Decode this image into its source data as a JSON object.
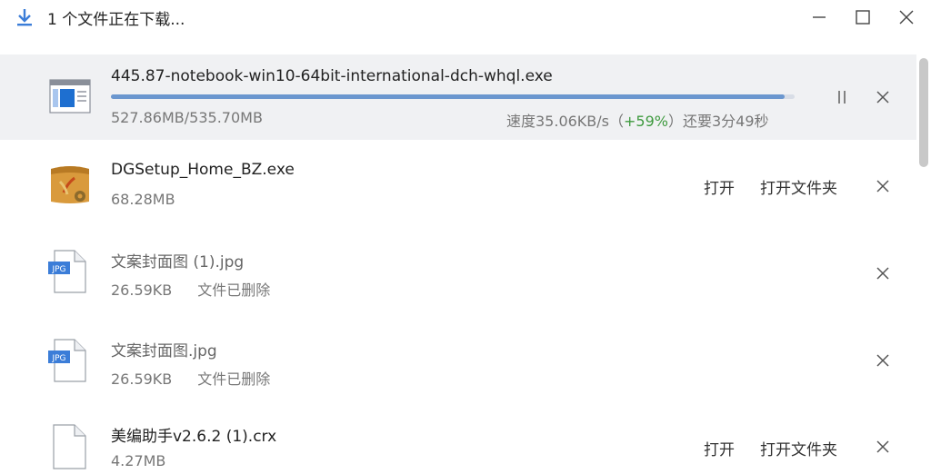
{
  "window": {
    "title": "1 个文件正在下载..."
  },
  "downloads": [
    {
      "name": "445.87-notebook-win10-64bit-international-dch-whql.exe",
      "size": "527.86MB/535.70MB",
      "speed_prefix": "速度35.06KB/s（",
      "speed_pct": "+59%",
      "speed_suffix": "）还要3分49秒",
      "progress_fraction": 0.985,
      "icon": "installer-window-icon"
    },
    {
      "name": "DGSetup_Home_BZ.exe",
      "size": "68.28MB",
      "open_label": "打开",
      "open_folder_label": "打开文件夹",
      "icon": "app-package-icon"
    },
    {
      "name": "文案封面图 (1).jpg",
      "size": "26.59KB",
      "status": "文件已删除",
      "icon": "jpg-file-icon"
    },
    {
      "name": "文案封面图.jpg",
      "size": "26.59KB",
      "status": "文件已删除",
      "icon": "jpg-file-icon"
    },
    {
      "name": "美编助手v2.6.2 (1).crx",
      "size": "4.27MB",
      "open_label": "打开",
      "open_folder_label": "打开文件夹",
      "icon": "blank-file-icon"
    }
  ],
  "colors": {
    "progress": "#6b97cf",
    "progress_track": "#d8dde6",
    "percent": "#3f9a3f",
    "active_row_bg": "#f0f1f3"
  }
}
